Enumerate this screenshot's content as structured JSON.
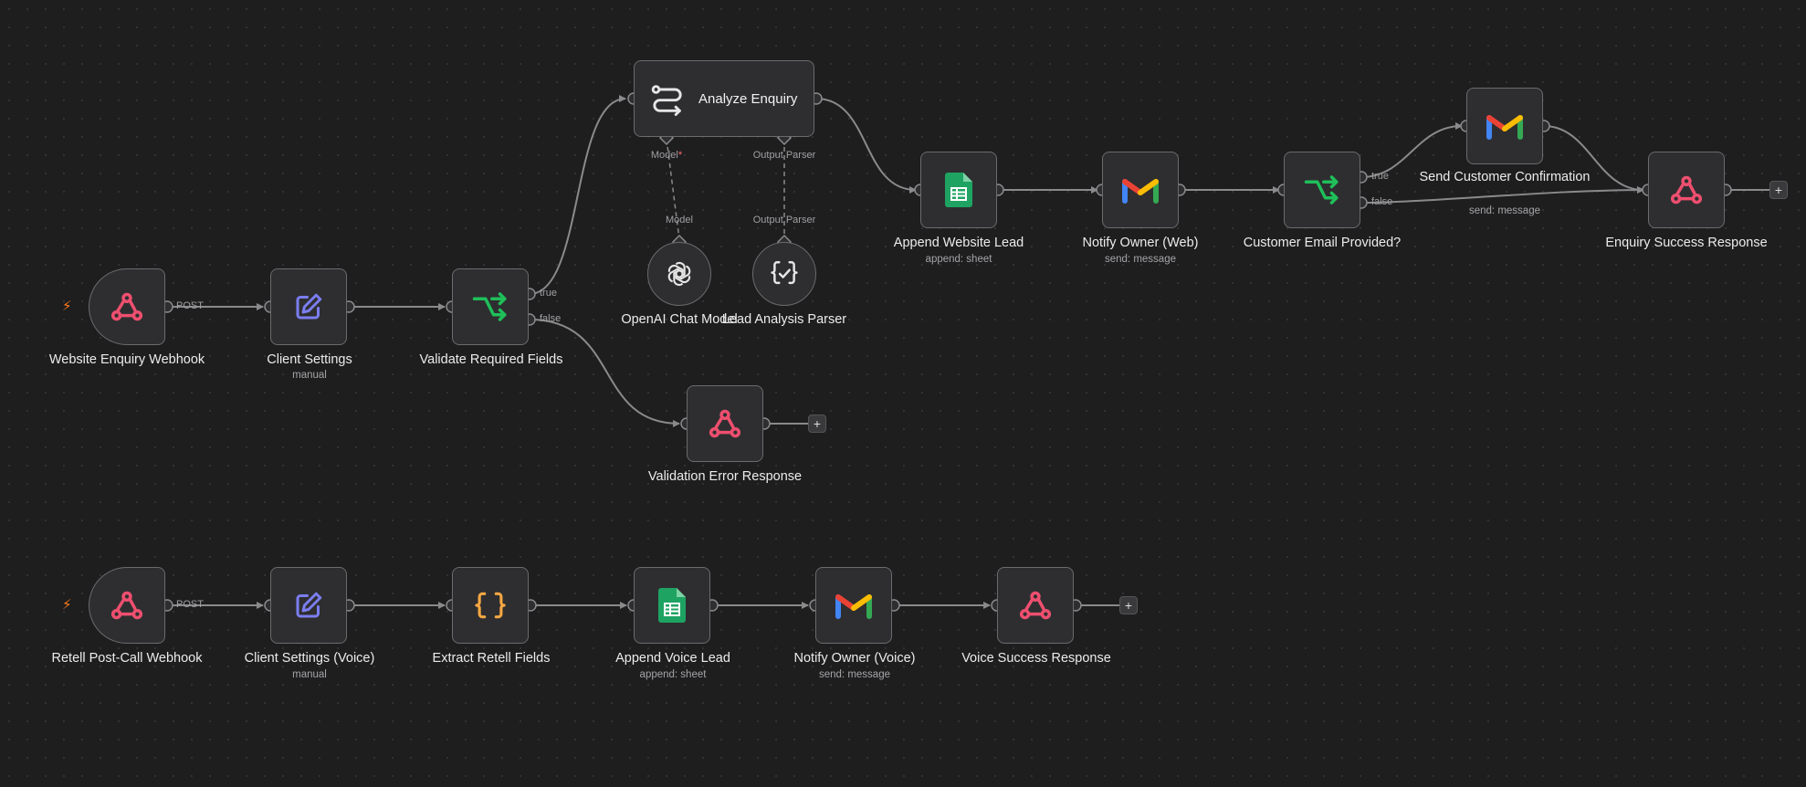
{
  "colors": {
    "canvas": "#1e1e1f",
    "node_fill": "#2e2e30",
    "node_border": "#6b6b6e",
    "edge": "#8a8a8c",
    "webhook_icon": "#ee4f6f",
    "edit_icon": "#7b7ef0",
    "if_icon": "#1fbf5a",
    "code_icon": "#f5a742",
    "sheets_icon": "#1ea362",
    "trigger_bolt": "#ff7a1a"
  },
  "top_flow": {
    "webhook": {
      "label": "Website Enquiry Webhook",
      "port_label": "POST",
      "icon": "webhook-icon"
    },
    "client_settings": {
      "label": "Client Settings",
      "sub": "manual",
      "icon": "pencil-square-icon"
    },
    "validate": {
      "label": "Validate Required Fields",
      "true_label": "true",
      "false_label": "false",
      "icon": "branch-icon"
    },
    "analyze": {
      "label": "Analyze Enquiry",
      "model_port": "Model",
      "model_required": "*",
      "parser_port": "Output Parser",
      "icon": "ai-agent-icon"
    },
    "openai": {
      "label": "OpenAI Chat Model",
      "port_label": "Model",
      "icon": "openai-icon"
    },
    "parser": {
      "label": "Lead Analysis Parser",
      "port_label": "Output Parser",
      "icon": "structured-parser-icon"
    },
    "validation_error": {
      "label": "Validation Error Response",
      "icon": "webhook-icon"
    },
    "append_lead": {
      "label": "Append Website Lead",
      "sub": "append: sheet",
      "icon": "google-sheets-icon"
    },
    "notify_web": {
      "label": "Notify Owner (Web)",
      "sub": "send: message",
      "icon": "gmail-icon"
    },
    "email_check": {
      "label": "Customer Email Provided?",
      "true_label": "true",
      "false_label": "false",
      "icon": "branch-icon"
    },
    "send_confirm": {
      "label": "Send Customer Confirmation",
      "sub": "send: message",
      "icon": "gmail-icon"
    },
    "success": {
      "label": "Enquiry Success Response",
      "icon": "webhook-icon"
    }
  },
  "bottom_flow": {
    "webhook": {
      "label": "Retell Post-Call Webhook",
      "port_label": "POST",
      "icon": "webhook-icon"
    },
    "client_settings": {
      "label": "Client Settings (Voice)",
      "sub": "manual",
      "icon": "pencil-square-icon"
    },
    "extract": {
      "label": "Extract Retell Fields",
      "icon": "curly-braces-icon"
    },
    "append_voice": {
      "label": "Append Voice Lead",
      "sub": "append: sheet",
      "icon": "google-sheets-icon"
    },
    "notify_voice": {
      "label": "Notify Owner (Voice)",
      "sub": "send: message",
      "icon": "gmail-icon"
    },
    "voice_success": {
      "label": "Voice Success Response",
      "icon": "webhook-icon"
    }
  },
  "add_button": "+",
  "trigger_icon": "⚡"
}
